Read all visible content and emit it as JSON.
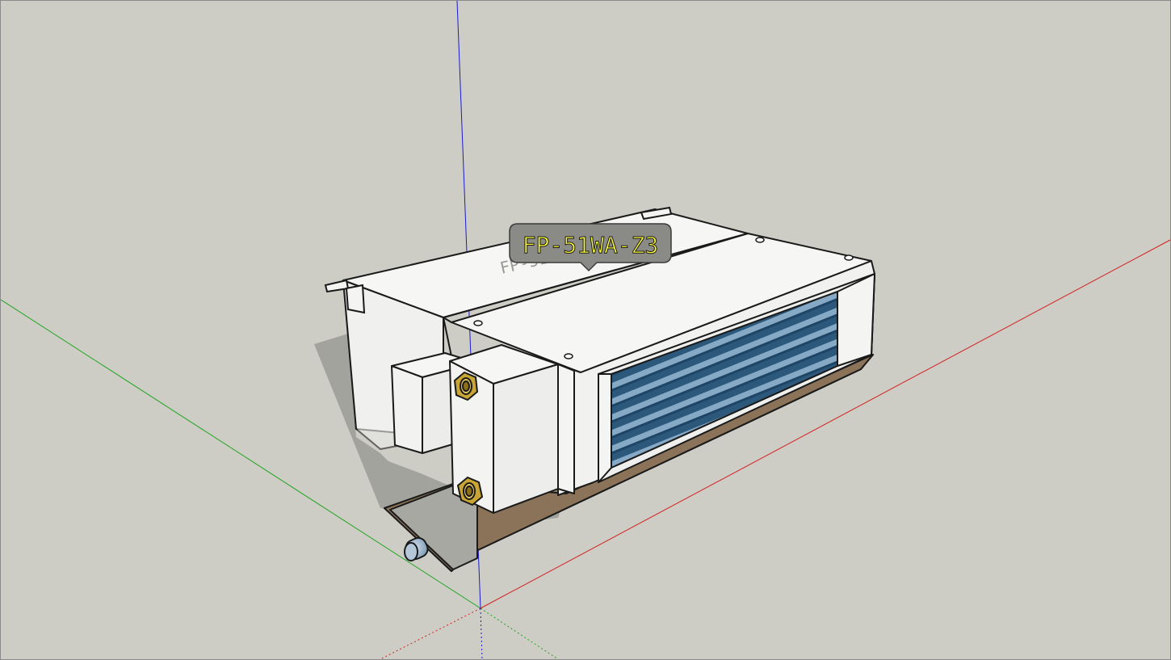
{
  "viewport": {
    "background": "#cdcdc6",
    "axes": {
      "red": "#d42020",
      "green": "#1fa51f",
      "blue": "#1b1bd0"
    }
  },
  "model": {
    "tag_label": "FP-51WA-Z3",
    "tag_text_color": "#ffff33",
    "tag_bg_color": "#8a8a86",
    "coil_color": "#3f6f95",
    "tray_color": "#9b8268",
    "fitting_color": "#c9a534"
  }
}
